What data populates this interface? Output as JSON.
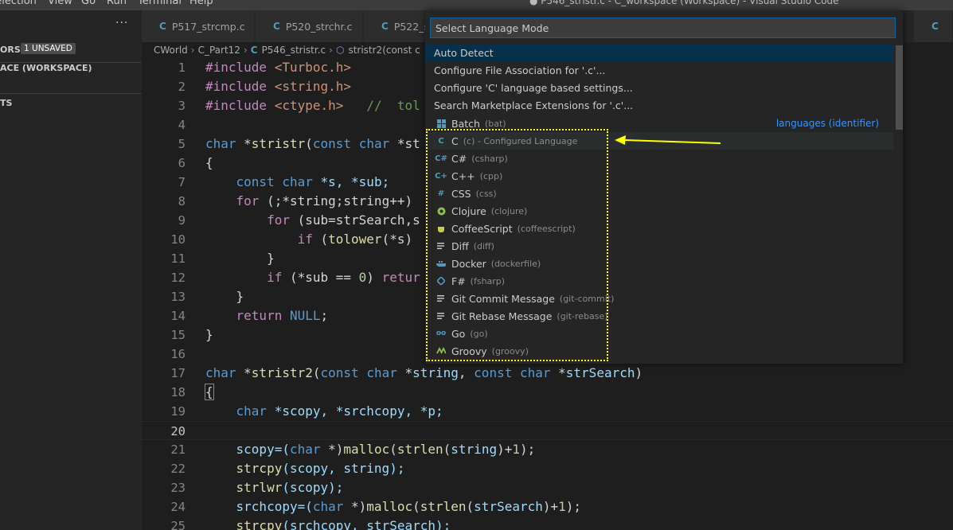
{
  "titlebar": {
    "menus": [
      "Selection",
      "View",
      "Go",
      "Run",
      "Terminal",
      "Help"
    ],
    "window_title": "● P546_stristr.c - C_workspace (Workspace) - Visual Studio Code"
  },
  "sidebar": {
    "more": "···",
    "open_editors": "ORS",
    "unsaved_badge": "1 UNSAVED",
    "workspace": "ACE (WORKSPACE)",
    "outline": "TS"
  },
  "tabs": [
    {
      "icon": "C",
      "label": "P517_strcmp.c"
    },
    {
      "icon": "C",
      "label": "P520_strchr.c"
    },
    {
      "icon": "C",
      "label": "P522_s"
    },
    {
      "icon": "C",
      "label": ""
    }
  ],
  "breadcrumb": {
    "folder1": "CWorld",
    "folder2": "C_Part12",
    "file_icon": "C",
    "file": "P546_stristr.c",
    "symbol": "stristr2(const c"
  },
  "editor": {
    "lines": [
      {
        "n": "1",
        "code": ""
      },
      {
        "n": "2",
        "code": ""
      },
      {
        "n": "3",
        "code": ""
      },
      {
        "n": "4",
        "code": ""
      },
      {
        "n": "5",
        "code": ""
      },
      {
        "n": "6",
        "code": ""
      },
      {
        "n": "7",
        "code": ""
      },
      {
        "n": "8",
        "code": ""
      },
      {
        "n": "9",
        "code": ""
      },
      {
        "n": "10",
        "code": ""
      },
      {
        "n": "11",
        "code": ""
      },
      {
        "n": "12",
        "code": ""
      },
      {
        "n": "13",
        "code": ""
      },
      {
        "n": "14",
        "code": ""
      },
      {
        "n": "15",
        "code": ""
      },
      {
        "n": "16",
        "code": ""
      },
      {
        "n": "17",
        "code": ""
      },
      {
        "n": "18",
        "code": ""
      },
      {
        "n": "19",
        "code": ""
      },
      {
        "n": "20",
        "code": ""
      },
      {
        "n": "21",
        "code": ""
      },
      {
        "n": "22",
        "code": ""
      },
      {
        "n": "23",
        "code": ""
      },
      {
        "n": "24",
        "code": ""
      },
      {
        "n": "25",
        "code": ""
      }
    ],
    "tokens": {
      "l1_kw": "#include",
      "l1_str": "<Turboc.h>",
      "l2_kw": "#include",
      "l2_str": "<string.h>",
      "l3_kw": "#include",
      "l3_str": "<ctype.h>",
      "l3_cm": "//  tol",
      "l5_t1": "char",
      "l5_t2": " *",
      "l5_f": "stristr",
      "l5_t3": "(",
      "l5_k1": "const",
      "l5_sp": " ",
      "l5_k2": "char",
      "l5_t4": " *st",
      "l6": "{",
      "l7_k1": "const",
      "l7_k2": "char",
      "l7_rest": " *s, *sub;",
      "l8_kw": "for",
      "l8_rest": " (;*string;string++)",
      "l9_kw": "for",
      "l9_rest": " (sub=strSearch,s",
      "l10_kw": "if",
      "l10_f": "tolower",
      "l10_rest": "(*s)",
      "l11": "}",
      "l12_kw": "if",
      "l12_a": " (*sub == ",
      "l12_num": "0",
      "l12_b": ") ",
      "l12_ret": "retur",
      "l13": "}",
      "l14_kw": "return",
      "l14_null": "NULL",
      "l14_end": ";",
      "l15": "}",
      "l17_k1": "char",
      "l17_f": "stristr2",
      "l17_k2": "const",
      "l17_k3": "char",
      "l17_v1": "string",
      "l17_k4": "const",
      "l17_k5": "char",
      "l17_v2": "strSearch",
      "l18": "{",
      "l19_kw": "char",
      "l19_rest": " *scopy, *srchcopy, *p;",
      "l21_a": "scopy=(",
      "l21_k": "char",
      "l21_b": " *)",
      "l21_f1": "malloc",
      "l21_c": "(",
      "l21_f2": "strlen",
      "l21_d": "(",
      "l21_v": "string",
      "l21_e": ")+",
      "l21_n": "1",
      "l21_g": ");",
      "l22_f": "strcpy",
      "l22_rest": "(scopy, string);",
      "l23_f": "strlwr",
      "l23_rest": "(scopy);",
      "l24_a": "srchcopy=(",
      "l24_k": "char",
      "l24_b": " *)",
      "l24_f1": "malloc",
      "l24_c": "(",
      "l24_f2": "strlen",
      "l24_d": "(",
      "l24_v": "strSearch",
      "l24_e": ")+",
      "l24_n": "1",
      "l24_g": ");",
      "l25_f": "strcpy",
      "l25_rest": "(srchcopy, strSearch);"
    }
  },
  "quickpick": {
    "placeholder": "Select Language Mode",
    "actions": [
      "Auto Detect",
      "Configure File Association for '.c'...",
      "Configure 'C' language based settings...",
      "Search Marketplace Extensions for '.c'..."
    ],
    "side_label": "languages (identifier)",
    "languages": [
      {
        "name": "Batch",
        "id": "(bat)",
        "icon": "windows-icon",
        "color": "#519aba"
      },
      {
        "name": "C",
        "id": "(c) - Configured Language",
        "icon": "c-icon",
        "color": "#519aba"
      },
      {
        "name": "C#",
        "id": "(csharp)",
        "icon": "csharp-icon",
        "color": "#519aba"
      },
      {
        "name": "C++",
        "id": "(cpp)",
        "icon": "cpp-icon",
        "color": "#519aba"
      },
      {
        "name": "CSS",
        "id": "(css)",
        "icon": "css-icon",
        "color": "#519aba"
      },
      {
        "name": "Clojure",
        "id": "(clojure)",
        "icon": "clojure-icon",
        "color": "#8dc149"
      },
      {
        "name": "CoffeeScript",
        "id": "(coffeescript)",
        "icon": "coffee-icon",
        "color": "#cbcb41"
      },
      {
        "name": "Diff",
        "id": "(diff)",
        "icon": "lines-icon",
        "color": "#cccccc"
      },
      {
        "name": "Docker",
        "id": "(dockerfile)",
        "icon": "docker-icon",
        "color": "#519aba"
      },
      {
        "name": "F#",
        "id": "(fsharp)",
        "icon": "fsharp-icon",
        "color": "#519aba"
      },
      {
        "name": "Git Commit Message",
        "id": "(git-commit)",
        "icon": "lines-icon",
        "color": "#cccccc"
      },
      {
        "name": "Git Rebase Message",
        "id": "(git-rebase)",
        "icon": "lines-icon",
        "color": "#cccccc"
      },
      {
        "name": "Go",
        "id": "(go)",
        "icon": "go-icon",
        "color": "#519aba"
      },
      {
        "name": "Groovy",
        "id": "(groovy)",
        "icon": "groovy-icon",
        "color": "#8dc149"
      }
    ]
  },
  "annotation": {
    "box_color": "#ffff00",
    "arrow_color": "#ffff00"
  }
}
